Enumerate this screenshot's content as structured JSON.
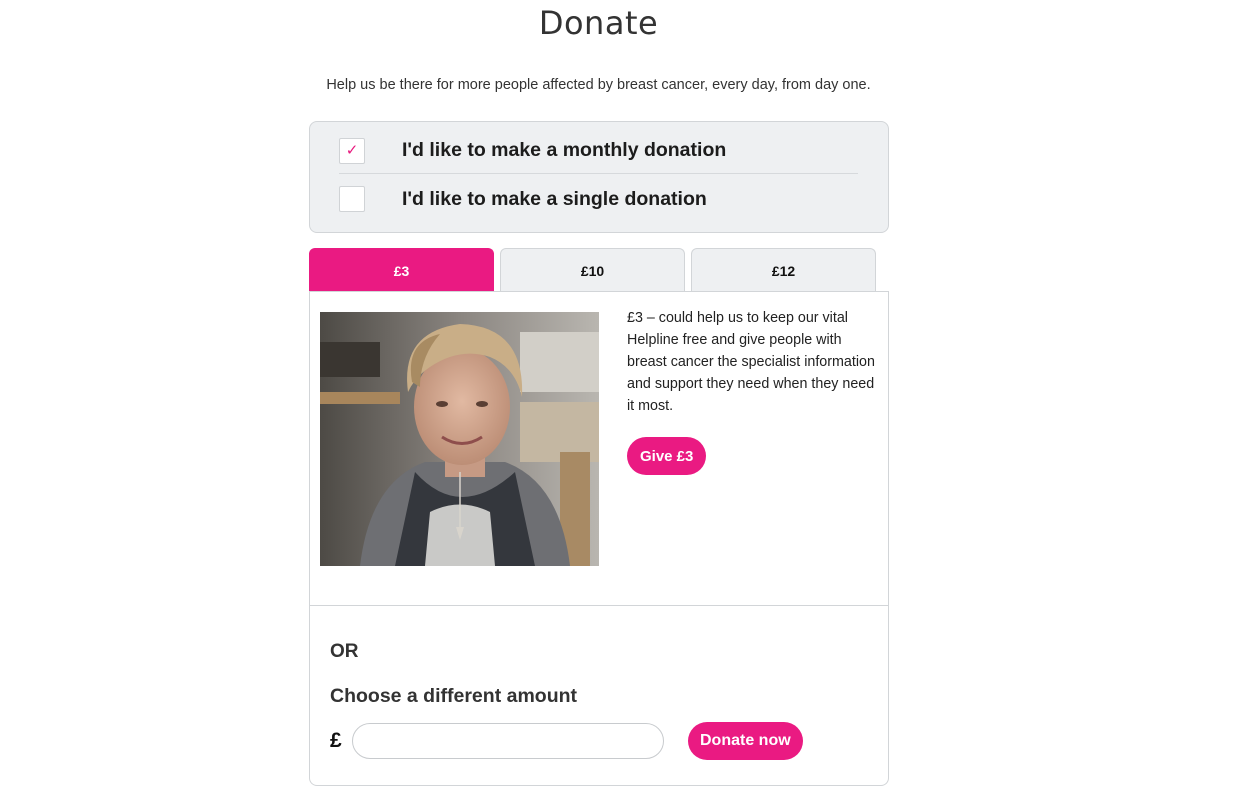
{
  "page": {
    "title": "Donate",
    "intro": "Help us be there for more people affected by breast cancer, every day, from day one."
  },
  "frequency": {
    "options": [
      {
        "label": "I'd like to make a monthly donation",
        "checked": true
      },
      {
        "label": "I'd like to make a single donation",
        "checked": false
      }
    ],
    "check_glyph": "✓"
  },
  "amount_tabs": [
    {
      "label": "£3",
      "active": true
    },
    {
      "label": "£10",
      "active": false
    },
    {
      "label": "£12",
      "active": false
    }
  ],
  "selected_amount": {
    "description": "£3 – could help us to keep our vital Helpline free and give people with breast cancer the specialist information and support they need when they need it most.",
    "give_button_label": "Give £3",
    "image_subject": "photo of smiling woman with short blonde hair"
  },
  "custom_amount": {
    "or_label": "OR",
    "heading": "Choose a different amount",
    "currency_symbol": "£",
    "input_value": "",
    "donate_button_label": "Donate now"
  },
  "colors": {
    "accent": "#ea1a82",
    "box_background": "#eef0f2",
    "border": "#d2d5d8"
  }
}
